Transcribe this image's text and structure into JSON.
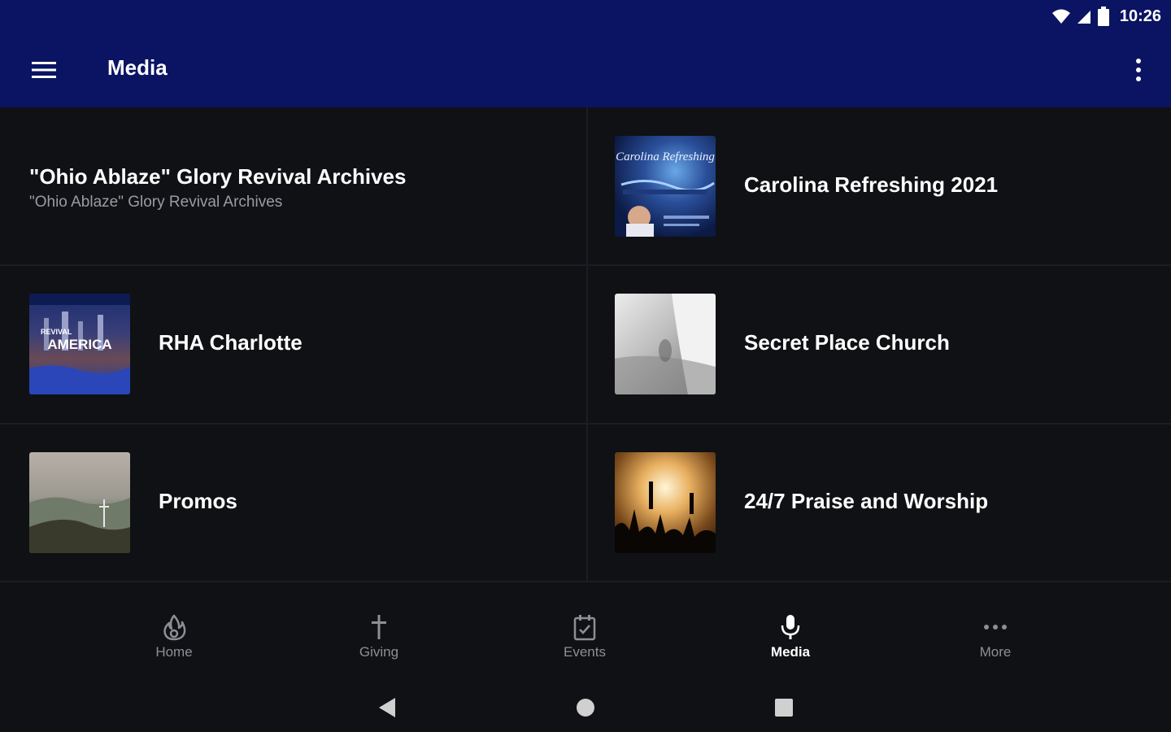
{
  "status": {
    "time": "10:26"
  },
  "appbar": {
    "title": "Media"
  },
  "items": [
    {
      "title": "\"Ohio Ablaze\" Glory Revival Archives",
      "subtitle": "\"Ohio Ablaze\" Glory Revival Archives"
    },
    {
      "title": "Carolina Refreshing 2021",
      "thumb_text": "Carolina Refreshing"
    },
    {
      "title": "RHA Charlotte",
      "thumb_text_top": "REVIVAL",
      "thumb_text": "AMERICA"
    },
    {
      "title": "Secret Place Church"
    },
    {
      "title": "Promos"
    },
    {
      "title": "24/7 Praise and Worship"
    }
  ],
  "nav": {
    "home": "Home",
    "giving": "Giving",
    "events": "Events",
    "media": "Media",
    "more": "More",
    "active": "media"
  },
  "colors": {
    "appbar": "#0b1462",
    "background": "#0f1114",
    "inactive": "#8d8f95"
  }
}
